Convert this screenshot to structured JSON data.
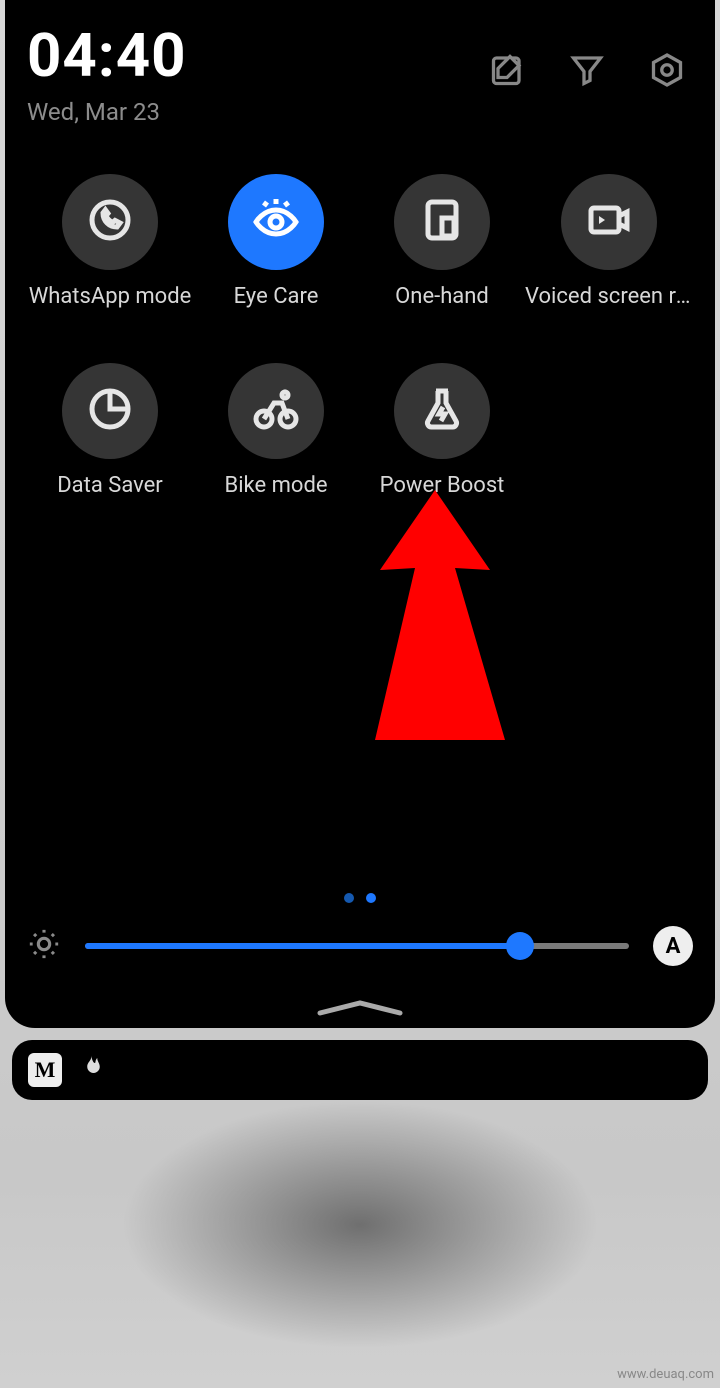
{
  "header": {
    "time": "04:40",
    "date": "Wed, Mar 23"
  },
  "tiles": [
    {
      "label": "WhatsApp mode",
      "active": false,
      "icon": "whatsapp-icon"
    },
    {
      "label": "Eye Care",
      "active": true,
      "icon": "eye-icon"
    },
    {
      "label": "One-hand",
      "active": false,
      "icon": "one-hand-icon"
    },
    {
      "label": "Voiced screen recording",
      "active": false,
      "icon": "voiced-screen-icon"
    },
    {
      "label": "Data Saver",
      "active": false,
      "icon": "data-saver-icon"
    },
    {
      "label": "Bike mode",
      "active": false,
      "icon": "bike-icon"
    },
    {
      "label": "Power Boost",
      "active": false,
      "icon": "flask-bolt-icon"
    }
  ],
  "pager": {
    "page_count": 2,
    "current": 2
  },
  "brightness": {
    "percent": 80,
    "auto_label": "A"
  },
  "notif": {
    "badge": "M"
  },
  "watermark": "www.deuaq.com"
}
